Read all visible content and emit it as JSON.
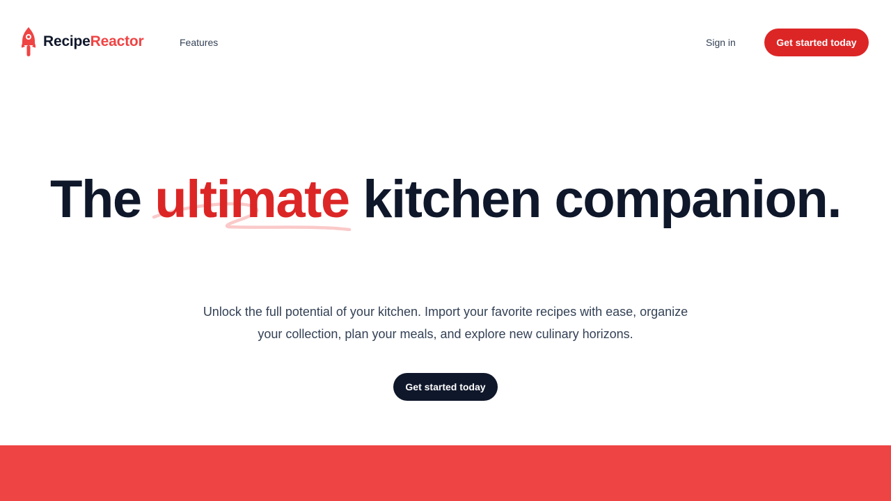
{
  "header": {
    "logo": {
      "name_part1": "Recipe",
      "name_part2": "Reactor",
      "icon": "rocket-icon"
    },
    "nav": {
      "features_label": "Features"
    },
    "sign_in_label": "Sign in",
    "cta_label": "Get started today"
  },
  "hero": {
    "title_before": "The ",
    "title_highlight": "ultimate",
    "title_after": " kitchen companion.",
    "subtitle": "Unlock the full potential of your kitchen. Import your favorite recipes with ease, organize your collection, plan your meals, and explore new culinary horizons.",
    "cta_label": "Get started today"
  },
  "colors": {
    "brand_red": "#dc2626",
    "logo_red": "#ef4444",
    "squiggle": "#fbc9c9",
    "dark": "#0f172a",
    "band": "#ef4444"
  }
}
